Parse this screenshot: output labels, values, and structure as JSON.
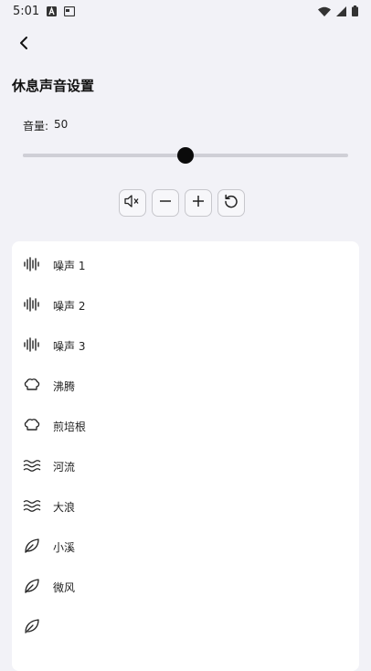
{
  "status_bar": {
    "time": "5:01",
    "left_icons": [
      "font-a-icon",
      "keyboard-icon"
    ],
    "right_icons": [
      "wifi-icon",
      "cell-signal-icon",
      "battery-icon"
    ]
  },
  "header": {
    "back_icon": "chevron-left-icon",
    "title": "休息声音设置"
  },
  "volume": {
    "label": "音量:",
    "value": "50",
    "level": 0.5
  },
  "controls": [
    {
      "name": "mute-button",
      "icon": "speaker-mute-icon"
    },
    {
      "name": "volume-down-button",
      "icon": "minus-icon"
    },
    {
      "name": "volume-up-button",
      "icon": "plus-icon"
    },
    {
      "name": "reset-button",
      "icon": "reset-icon"
    }
  ],
  "sounds": [
    {
      "label": "噪声 1",
      "icon": "waveform-icon"
    },
    {
      "label": "噪声 2",
      "icon": "waveform-icon"
    },
    {
      "label": "噪声 3",
      "icon": "waveform-icon"
    },
    {
      "label": "沸腾",
      "icon": "chef-hat-icon"
    },
    {
      "label": "煎培根",
      "icon": "chef-hat-icon"
    },
    {
      "label": "河流",
      "icon": "waves-icon"
    },
    {
      "label": "大浪",
      "icon": "waves-icon"
    },
    {
      "label": "小溪",
      "icon": "leaf-icon"
    },
    {
      "label": "微风",
      "icon": "leaf-icon"
    },
    {
      "label": "",
      "icon": "leaf-icon"
    }
  ],
  "colors": {
    "background": "#f2f2f7",
    "card": "#ffffff",
    "slider_thumb": "#0b0b0b",
    "slider_track": "#cfcfd6"
  }
}
